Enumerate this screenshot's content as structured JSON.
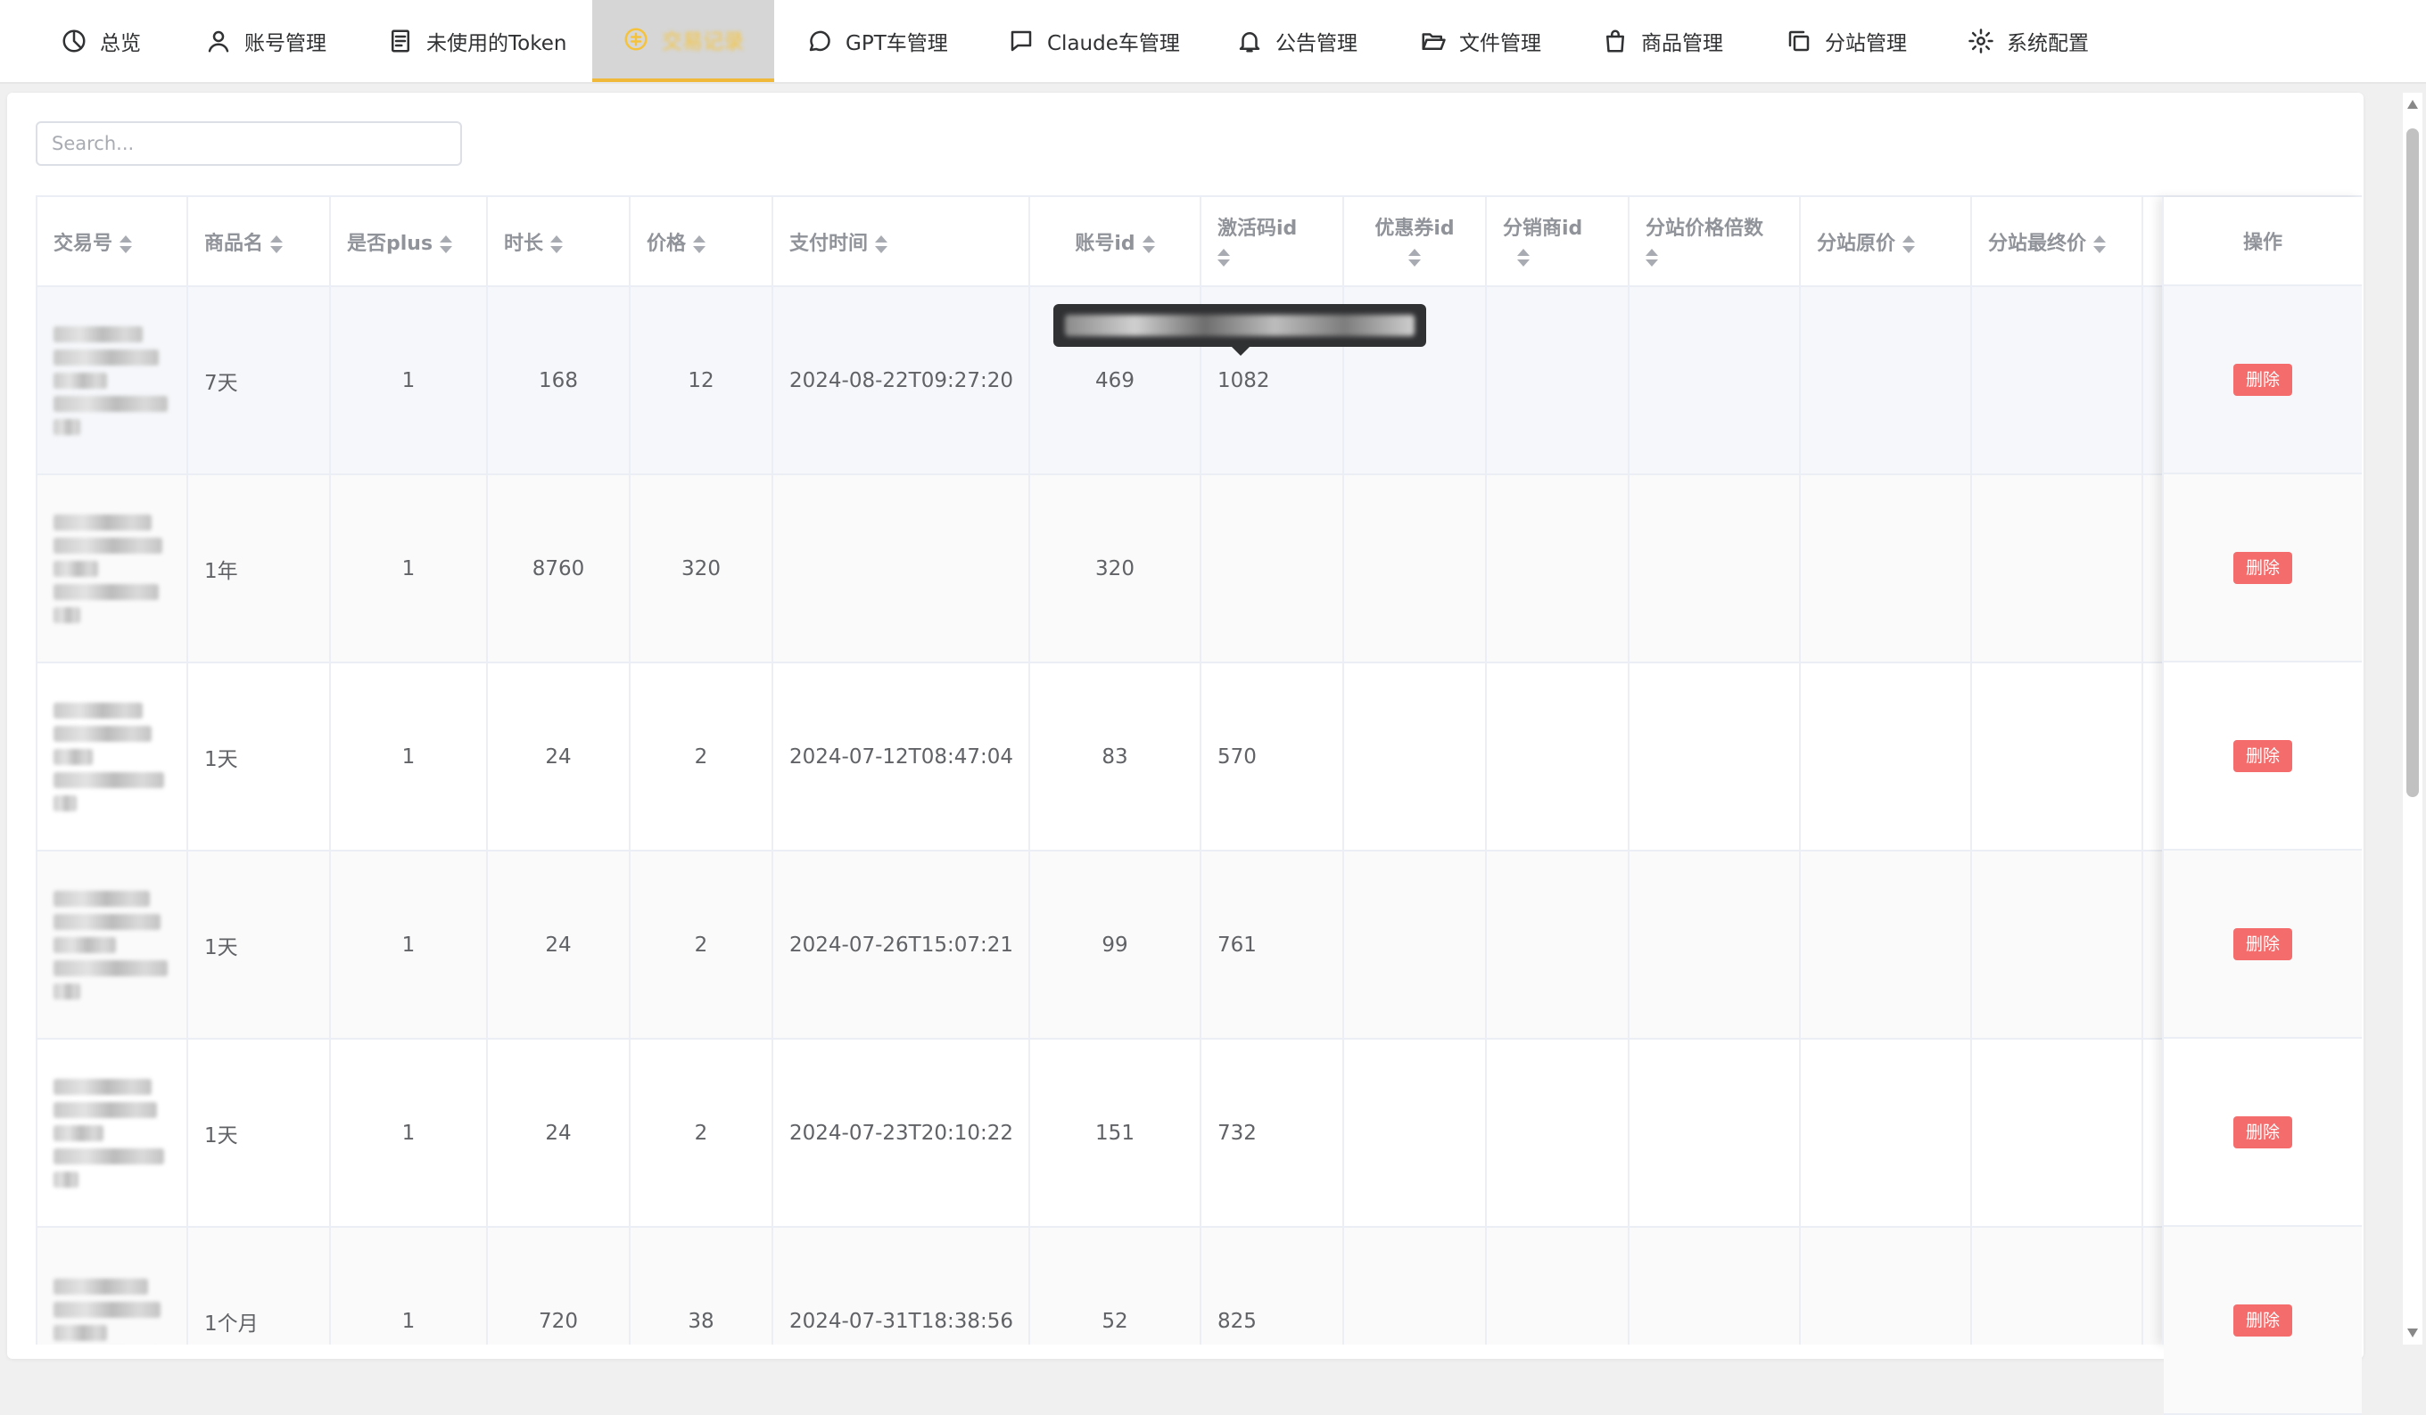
{
  "nav": {
    "items": [
      {
        "label": "总览",
        "icon": "pie-chart-icon"
      },
      {
        "label": "账号管理",
        "icon": "user-icon"
      },
      {
        "label": "未使用的Token",
        "icon": "document-icon"
      },
      {
        "label": "交易记录",
        "icon": "coins-icon",
        "active": true
      },
      {
        "label": "GPT车管理",
        "icon": "chat-bubble-icon"
      },
      {
        "label": "Claude车管理",
        "icon": "message-square-icon"
      },
      {
        "label": "公告管理",
        "icon": "bell-icon"
      },
      {
        "label": "文件管理",
        "icon": "folder-open-icon"
      },
      {
        "label": "商品管理",
        "icon": "shopping-bag-icon"
      },
      {
        "label": "分站管理",
        "icon": "copy-icon"
      },
      {
        "label": "系统配置",
        "icon": "gear-icon"
      }
    ]
  },
  "search": {
    "placeholder": "Search..."
  },
  "table": {
    "headers": {
      "tx_id": "交易号",
      "product": "商品名",
      "is_plus": "是否plus",
      "duration": "时长",
      "price": "价格",
      "paid_at": "支付时间",
      "account_id": "账号id",
      "code_id": "激活码id",
      "coupon_id": "优惠券id",
      "distributor_id": "分销商id",
      "substation_multiplier": "分站价格倍数",
      "substation_original": "分站原价",
      "substation_final": "分站最终价",
      "actions": "操作"
    },
    "rows": [
      {
        "product": "7天",
        "is_plus": "1",
        "duration": "168",
        "price": "12",
        "paid_at": "2024-08-22T09:27:20",
        "account_id": "469",
        "code_id": "1082",
        "action": "删除"
      },
      {
        "product": "1年",
        "is_plus": "1",
        "duration": "8760",
        "price": "320",
        "paid_at": "",
        "account_id": "320",
        "code_id": "",
        "action": "删除"
      },
      {
        "product": "1天",
        "is_plus": "1",
        "duration": "24",
        "price": "2",
        "paid_at": "2024-07-12T08:47:04",
        "account_id": "83",
        "code_id": "570",
        "action": "删除"
      },
      {
        "product": "1天",
        "is_plus": "1",
        "duration": "24",
        "price": "2",
        "paid_at": "2024-07-26T15:07:21",
        "account_id": "99",
        "code_id": "761",
        "action": "删除"
      },
      {
        "product": "1天",
        "is_plus": "1",
        "duration": "24",
        "price": "2",
        "paid_at": "2024-07-23T20:10:22",
        "account_id": "151",
        "code_id": "732",
        "action": "删除"
      },
      {
        "product": "1个月",
        "is_plus": "1",
        "duration": "720",
        "price": "38",
        "paid_at": "2024-07-31T18:38:56",
        "account_id": "52",
        "code_id": "825",
        "action": "删除"
      }
    ]
  },
  "colors": {
    "accent": "#f0b93a",
    "danger": "#f56c6c"
  }
}
